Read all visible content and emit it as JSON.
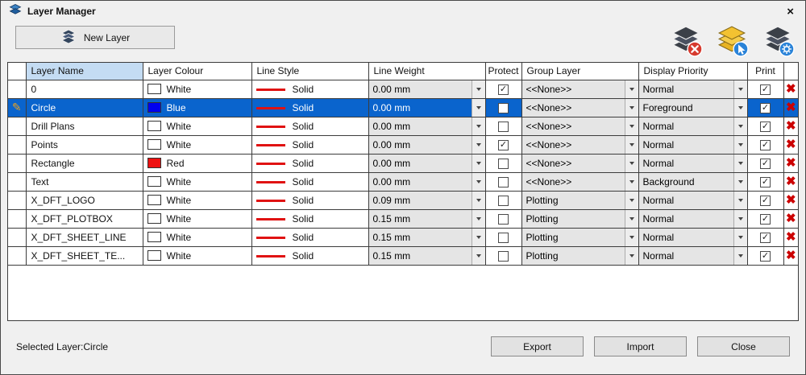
{
  "window": {
    "title": "Layer Manager",
    "close_glyph": "×"
  },
  "toolbar": {
    "new_layer_label": "New Layer",
    "icons": {
      "new_layer": "layers-stack-icon",
      "delete": "layers-delete-icon",
      "select": "layers-select-icon",
      "settings": "layers-settings-icon"
    }
  },
  "colors": {
    "selection": "#0a64cd",
    "header_highlight": "#c4dcf3",
    "delete_red": "#cc0000",
    "line_red": "#e01212"
  },
  "table": {
    "headers": {
      "name": "Layer Name",
      "colour": "Layer Colour",
      "line_style": "Line Style",
      "line_weight": "Line Weight",
      "protect": "Protect",
      "group": "Group Layer",
      "priority": "Display Priority",
      "print": "Print"
    },
    "rows": [
      {
        "name": "0",
        "colour": "White",
        "colour_hex": "#ffffff",
        "line_style": "Solid",
        "line_weight": "0.00 mm",
        "protect": true,
        "group": "<<None>>",
        "priority": "Normal",
        "print": true,
        "selected": false
      },
      {
        "name": "Circle",
        "colour": "Blue",
        "colour_hex": "#0000f0",
        "line_style": "Solid",
        "line_weight": "0.00 mm",
        "protect": false,
        "group": "<<None>>",
        "priority": "Foreground",
        "print": true,
        "selected": true
      },
      {
        "name": "Drill Plans",
        "colour": "White",
        "colour_hex": "#ffffff",
        "line_style": "Solid",
        "line_weight": "0.00 mm",
        "protect": false,
        "group": "<<None>>",
        "priority": "Normal",
        "print": true,
        "selected": false
      },
      {
        "name": "Points",
        "colour": "White",
        "colour_hex": "#ffffff",
        "line_style": "Solid",
        "line_weight": "0.00 mm",
        "protect": true,
        "group": "<<None>>",
        "priority": "Normal",
        "print": true,
        "selected": false
      },
      {
        "name": "Rectangle",
        "colour": "Red",
        "colour_hex": "#ee1111",
        "line_style": "Solid",
        "line_weight": "0.00 mm",
        "protect": false,
        "group": "<<None>>",
        "priority": "Normal",
        "print": true,
        "selected": false
      },
      {
        "name": "Text",
        "colour": "White",
        "colour_hex": "#ffffff",
        "line_style": "Solid",
        "line_weight": "0.00 mm",
        "protect": false,
        "group": "<<None>>",
        "priority": "Background",
        "print": true,
        "selected": false
      },
      {
        "name": "X_DFT_LOGO",
        "colour": "White",
        "colour_hex": "#ffffff",
        "line_style": "Solid",
        "line_weight": "0.09 mm",
        "protect": false,
        "group": "Plotting",
        "priority": "Normal",
        "print": true,
        "selected": false
      },
      {
        "name": "X_DFT_PLOTBOX",
        "colour": "White",
        "colour_hex": "#ffffff",
        "line_style": "Solid",
        "line_weight": "0.15 mm",
        "protect": false,
        "group": "Plotting",
        "priority": "Normal",
        "print": true,
        "selected": false
      },
      {
        "name": "X_DFT_SHEET_LINE",
        "colour": "White",
        "colour_hex": "#ffffff",
        "line_style": "Solid",
        "line_weight": "0.15 mm",
        "protect": false,
        "group": "Plotting",
        "priority": "Normal",
        "print": true,
        "selected": false
      },
      {
        "name": "X_DFT_SHEET_TE...",
        "colour": "White",
        "colour_hex": "#ffffff",
        "line_style": "Solid",
        "line_weight": "0.15 mm",
        "protect": false,
        "group": "Plotting",
        "priority": "Normal",
        "print": true,
        "selected": false
      }
    ]
  },
  "footer": {
    "selected_text": "Selected Layer:Circle",
    "export_label": "Export",
    "import_label": "Import",
    "close_label": "Close"
  }
}
